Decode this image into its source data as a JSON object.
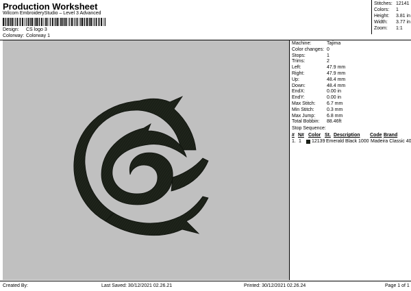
{
  "header": {
    "title": "Production Worksheet",
    "subtitle": "Wilcom EmbroideryStudio – Level 3 Advanced",
    "design_label": "Design:",
    "design_value": "CS logo 3",
    "colorway_label": "Colorway:",
    "colorway_value": "Colorway 1"
  },
  "summary": {
    "stitches_label": "Stitches:",
    "stitches_value": "12141",
    "colors_label": "Colors:",
    "colors_value": "1",
    "height_label": "Height:",
    "height_value": "3.81 in",
    "width_label": "Width:",
    "width_value": "3.77 in",
    "zoom_label": "Zoom:",
    "zoom_value": "1:1"
  },
  "details": [
    {
      "label": "Machine:",
      "value": "Tajima"
    },
    {
      "label": "Color changes:",
      "value": "0"
    },
    {
      "label": "Stops:",
      "value": "1"
    },
    {
      "label": "Trims:",
      "value": "2"
    },
    {
      "label": "Left:",
      "value": "47.9 mm"
    },
    {
      "label": "Right:",
      "value": "47.9 mm"
    },
    {
      "label": "Up:",
      "value": "48.4 mm"
    },
    {
      "label": "Down:",
      "value": "48.4 mm"
    },
    {
      "label": "EndX:",
      "value": "0.00 in"
    },
    {
      "label": "EndY:",
      "value": "0.00 in"
    },
    {
      "label": "Max Stitch:",
      "value": "6.7 mm"
    },
    {
      "label": "Min Stitch:",
      "value": "0.3 mm"
    },
    {
      "label": "Max Jump:",
      "value": "6.8 mm"
    },
    {
      "label": "Total Bobbin:",
      "value": "88.46ft"
    }
  ],
  "stop_sequence": {
    "heading": "Stop Sequence:",
    "columns": [
      "#",
      "N#",
      "Color",
      "St.",
      "Description",
      "Code",
      "Brand"
    ],
    "rows": [
      {
        "num": "1.",
        "needle": "1",
        "color": "#1a1f17",
        "stitches": "12139",
        "description": "Emerald Black",
        "code": "1000",
        "brand": "Madeira Classic 40"
      }
    ]
  },
  "footer": {
    "created_by": "Created By:",
    "last_saved": "Last Saved: 30/12/2021 02.26.21",
    "printed": "Printed: 30/12/2021 02.26.24",
    "page": "Page 1 of 1"
  },
  "colors": {
    "canvas_bg": "#c0c0c0",
    "thread": "#1a1f17"
  }
}
